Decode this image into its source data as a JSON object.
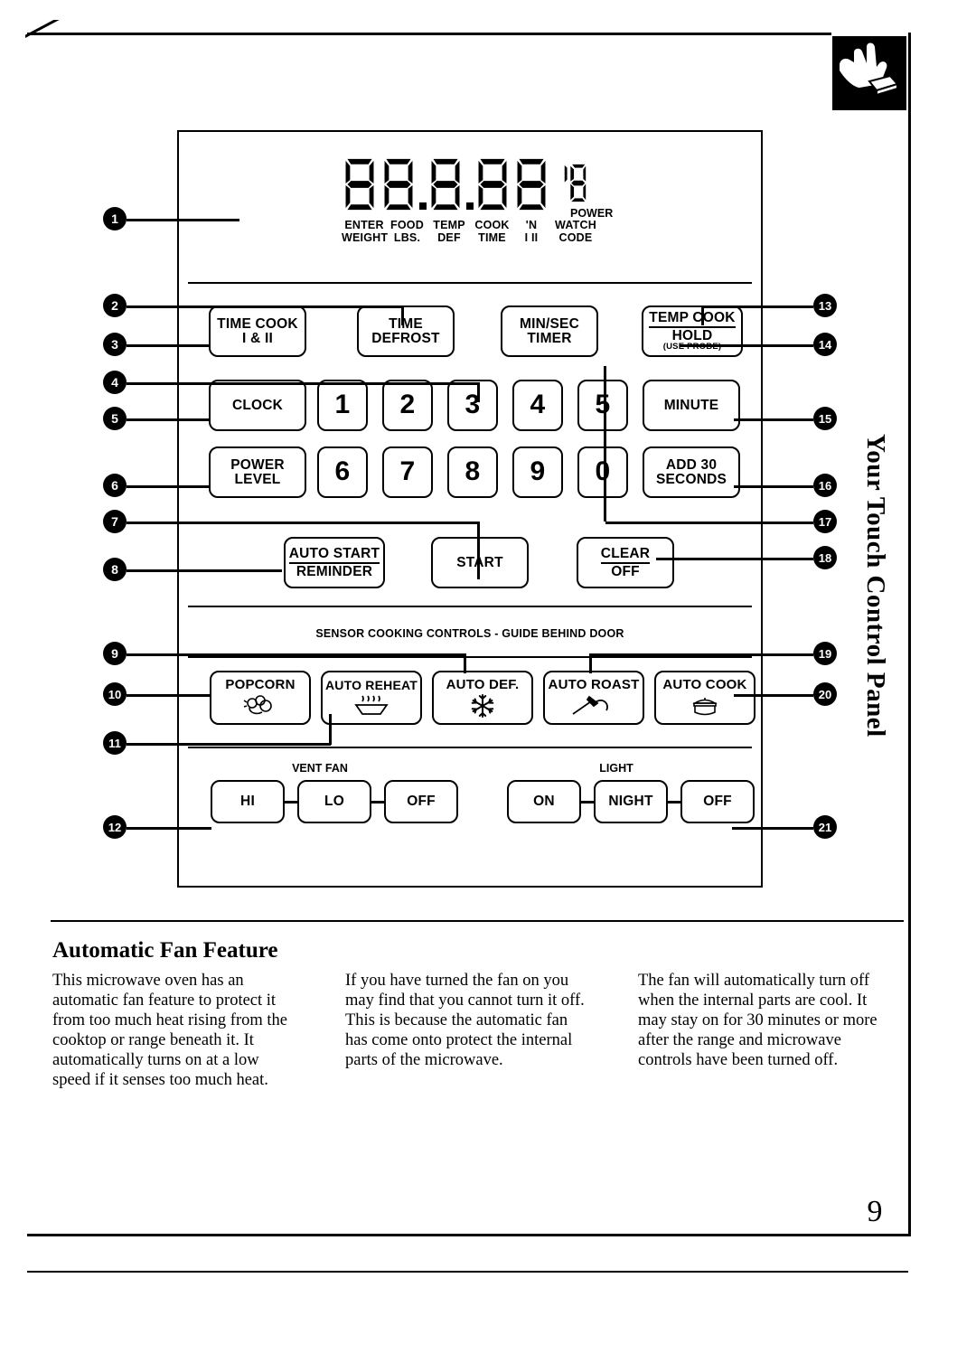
{
  "page": {
    "number": "9",
    "side_title": "Your Touch Control Panel",
    "touch_icon": "hand-press-icon"
  },
  "display": {
    "digits": [
      "8",
      "8",
      "8",
      "8",
      "8"
    ],
    "power_digits": "18",
    "power_label": "POWER",
    "labels_row1": [
      "ENTER",
      "FOOD",
      "TEMP",
      "COOK",
      "'N",
      "WATCH"
    ],
    "labels_row2": [
      "WEIGHT",
      "LBS.",
      "DEF",
      "TIME",
      "I  II",
      "CODE"
    ]
  },
  "panel": {
    "sensor_heading": "SENSOR COOKING CONTROLS - GUIDE BEHIND DOOR",
    "vent_fan_label": "VENT FAN",
    "light_label": "LIGHT",
    "buttons": {
      "time_cook": {
        "l1": "TIME COOK",
        "l2": "I & II"
      },
      "time_defrost": {
        "l1": "TIME",
        "l2": "DEFROST"
      },
      "min_sec_timer": {
        "l1": "MIN/SEC",
        "l2": "TIMER"
      },
      "temp_cook_hold": {
        "l1": "TEMP COOK",
        "l2": "HOLD",
        "l3": "(USE PROBE)"
      },
      "clock": {
        "l1": "CLOCK"
      },
      "power_level": {
        "l1": "POWER",
        "l2": "LEVEL"
      },
      "minute": {
        "l1": "MINUTE"
      },
      "add_30_seconds": {
        "l1": "ADD 30",
        "l2": "SECONDS"
      },
      "auto_start_reminder": {
        "l1": "AUTO START",
        "l2": "REMINDER"
      },
      "start": {
        "l1": "START"
      },
      "clear_off": {
        "l1": "CLEAR",
        "l2": "OFF"
      },
      "popcorn": {
        "l1": "POPCORN",
        "icon": "popcorn-icon"
      },
      "auto_reheat": {
        "l1": "AUTO REHEAT",
        "icon": "steaming-dish-icon"
      },
      "auto_def": {
        "l1": "AUTO DEF.",
        "icon": "snowflake-icon"
      },
      "auto_roast": {
        "l1": "AUTO ROAST",
        "icon": "temperature-probe-icon"
      },
      "auto_cook": {
        "l1": "AUTO COOK",
        "icon": "covered-pot-icon"
      },
      "vent_hi": {
        "l1": "HI"
      },
      "vent_lo": {
        "l1": "LO"
      },
      "vent_off": {
        "l1": "OFF"
      },
      "light_on": {
        "l1": "ON"
      },
      "light_night": {
        "l1": "NIGHT"
      },
      "light_off": {
        "l1": "OFF"
      }
    },
    "numpad": [
      "1",
      "2",
      "3",
      "4",
      "5",
      "6",
      "7",
      "8",
      "9",
      "0"
    ]
  },
  "callouts": {
    "left": [
      "1",
      "2",
      "3",
      "4",
      "5",
      "6",
      "7",
      "8",
      "9",
      "10",
      "11",
      "12"
    ],
    "right": [
      "13",
      "14",
      "15",
      "16",
      "17",
      "18",
      "19",
      "20",
      "21"
    ]
  },
  "article": {
    "title": "Automatic Fan Feature",
    "col1": "This microwave oven has an automatic fan feature to protect it from too much heat rising from the cooktop or range beneath it. It automatically turns on at a low speed if it senses too much heat.",
    "col2": "If you have turned the fan on you may find that you cannot turn it off. This is because the automatic fan has come onto protect the internal parts of the microwave.",
    "col3": "The fan will automatically turn off when the internal parts are cool. It may stay on for 30 minutes or more after the range and microwave controls have been turned off."
  }
}
